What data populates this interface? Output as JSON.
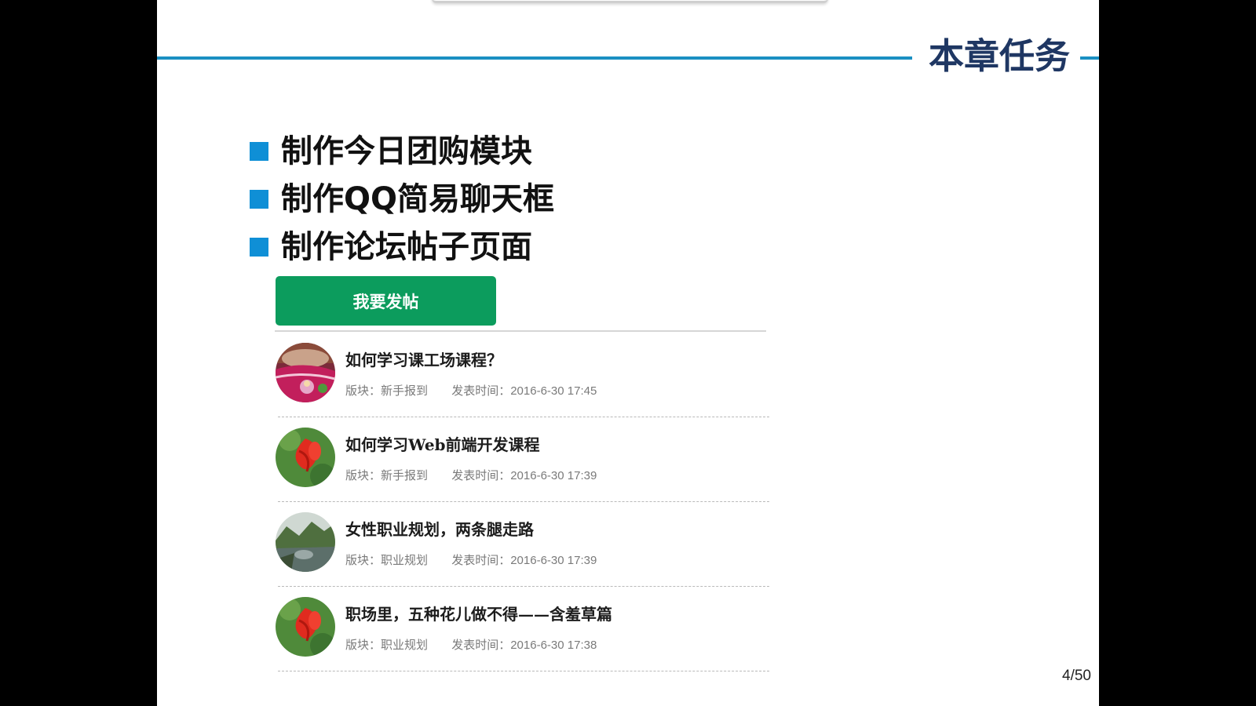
{
  "slide": {
    "chapter_title": "本章任务",
    "page_number": "4/50",
    "accent_color": "#1a8fc2",
    "bullet_color": "#0f8fd6"
  },
  "tasks": [
    "制作今日团购模块",
    "制作QQ简易聊天框",
    "制作论坛帖子页面"
  ],
  "forum": {
    "post_button_label": "我要发帖",
    "button_color": "#0c9c5d",
    "board_prefix": "版块：",
    "time_prefix": "发表时间：",
    "posts": [
      {
        "title": "如何学习课工场课程？",
        "board": "新手报到",
        "time": "2016-6-30 17:45",
        "avatar_icon": "kids-photo-icon"
      },
      {
        "title": "如何学习Web前端开发课程",
        "board": "新手报到",
        "time": "2016-6-30 17:39",
        "avatar_icon": "red-flower-icon"
      },
      {
        "title": "女性职业规划，两条腿走路",
        "board": "职业规划",
        "time": "2016-6-30 17:39",
        "avatar_icon": "landscape-icon"
      },
      {
        "title": "职场里，五种花儿做不得——含羞草篇",
        "board": "职业规划",
        "time": "2016-6-30 17:38",
        "avatar_icon": "red-flower-icon"
      }
    ]
  }
}
